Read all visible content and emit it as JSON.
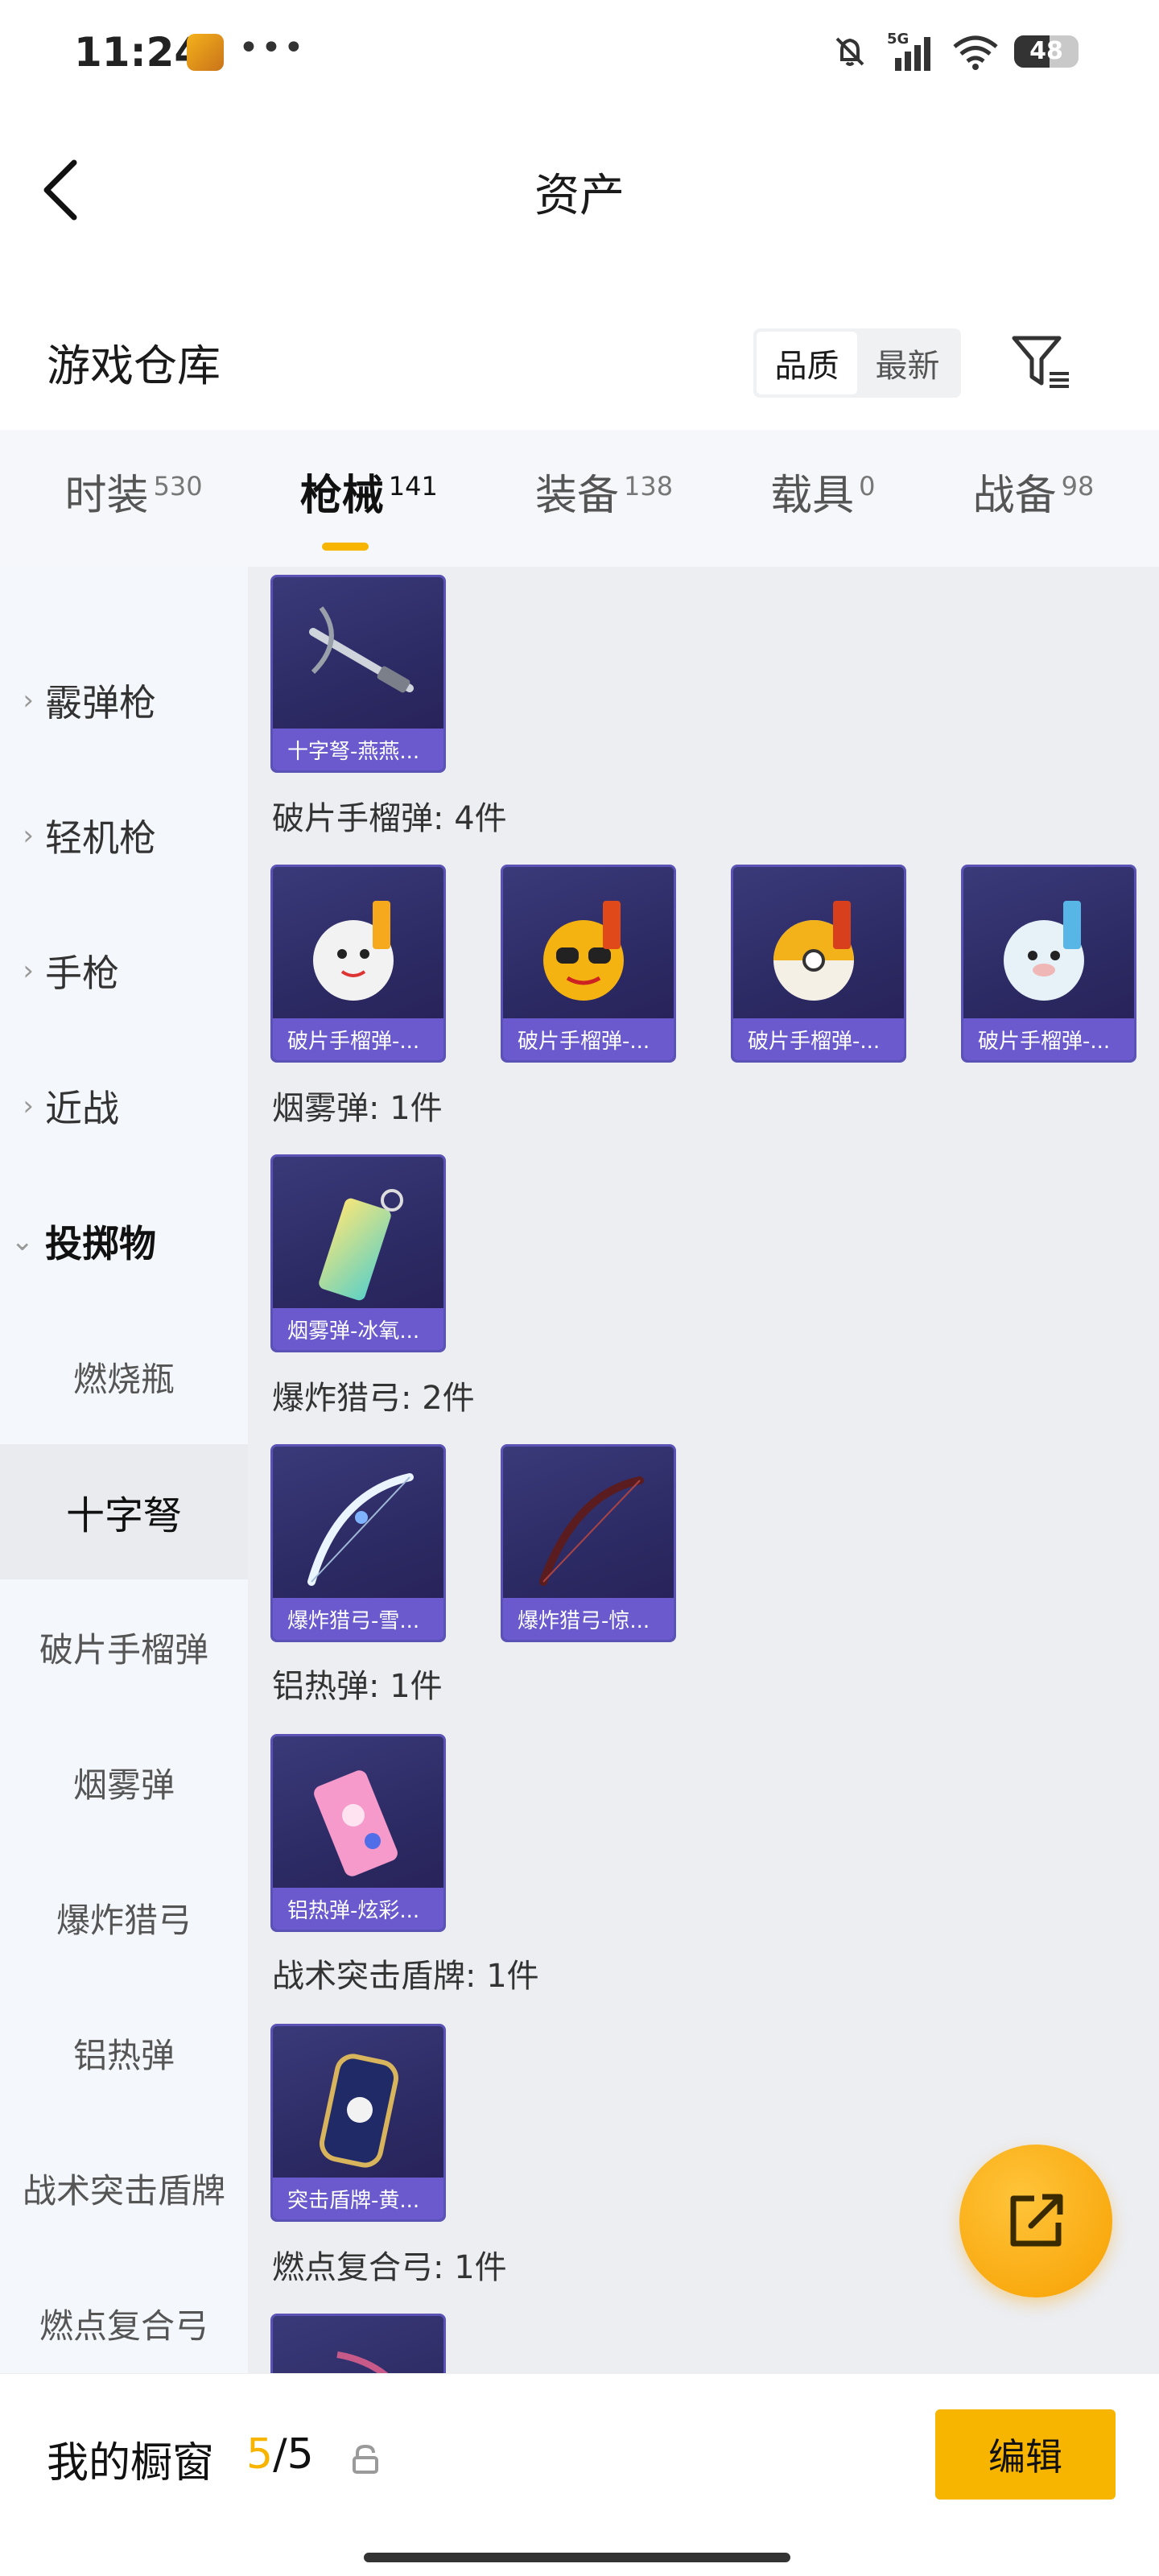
{
  "status_bar": {
    "time": "11:24",
    "more": "•••",
    "battery": "48",
    "icons": [
      "mute-icon",
      "signal-5g-icon",
      "wifi-icon",
      "battery-icon"
    ]
  },
  "header": {
    "title": "资产"
  },
  "section": {
    "title": "游戏仓库",
    "sort_options": [
      "品质",
      "最新"
    ],
    "sort_selected": "品质"
  },
  "tabs": [
    {
      "label": "时装",
      "count": "530"
    },
    {
      "label": "枪械",
      "count": "141",
      "active": true
    },
    {
      "label": "装备",
      "count": "138"
    },
    {
      "label": "载具",
      "count": "0"
    },
    {
      "label": "战备",
      "count": "98"
    }
  ],
  "sidebar": {
    "categories": [
      {
        "label": "霰弹枪",
        "chevron": "›"
      },
      {
        "label": "轻机枪",
        "chevron": "›"
      },
      {
        "label": "手枪",
        "chevron": "›"
      },
      {
        "label": "近战",
        "chevron": "›"
      },
      {
        "label": "投掷物",
        "chevron": "⌄"
      }
    ],
    "subitems": [
      "燃烧瓶",
      "十字弩",
      "破片手榴弹",
      "烟雾弹",
      "爆炸猎弓",
      "铝热弹",
      "战术突击盾牌",
      "燃点复合弓"
    ],
    "selected": "十字弩"
  },
  "groups": [
    {
      "title": "",
      "items": [
        "十字弩-燕燕..."
      ]
    },
    {
      "title": "破片手榴弹: 4件",
      "items": [
        "破片手榴弹-...",
        "破片手榴弹-...",
        "破片手榴弹-...",
        "破片手榴弹-..."
      ]
    },
    {
      "title": "烟雾弹: 1件",
      "items": [
        "烟雾弹-冰氧..."
      ]
    },
    {
      "title": "爆炸猎弓: 2件",
      "items": [
        "爆炸猎弓-雪...",
        "爆炸猎弓-惊..."
      ]
    },
    {
      "title": "铝热弹: 1件",
      "items": [
        "铝热弹-炫彩..."
      ]
    },
    {
      "title": "战术突击盾牌: 1件",
      "items": [
        "突击盾牌-黄..."
      ]
    },
    {
      "title": "燃点复合弓: 1件",
      "items": [
        ""
      ]
    }
  ],
  "bottom": {
    "window_label": "我的橱窗",
    "window_current": "5",
    "window_sep": "/",
    "window_total": "5",
    "edit_label": "编辑"
  },
  "colors": {
    "accent": "#f7b500",
    "card_caption": "#6a5acd",
    "card_bg": "#2c2a63"
  }
}
